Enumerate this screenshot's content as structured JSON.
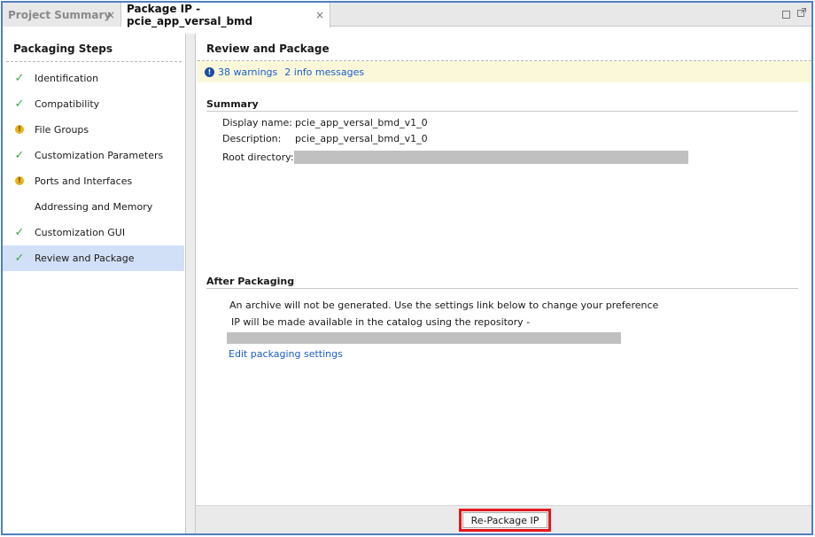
{
  "tabs": [
    {
      "label": "Project Summary",
      "active": false
    },
    {
      "label": "Package IP - pcie_app_versal_bmd",
      "active": true
    }
  ],
  "tab_close_glyph": "×",
  "left_panel": {
    "title": "Packaging Steps",
    "steps": [
      {
        "label": "Identification",
        "status": "check"
      },
      {
        "label": "Compatibility",
        "status": "check"
      },
      {
        "label": "File Groups",
        "status": "warning"
      },
      {
        "label": "Customization Parameters",
        "status": "check"
      },
      {
        "label": "Ports and Interfaces",
        "status": "warning"
      },
      {
        "label": "Addressing and Memory",
        "status": "none"
      },
      {
        "label": "Customization GUI",
        "status": "check"
      },
      {
        "label": "Review and Package",
        "status": "check",
        "selected": true
      }
    ]
  },
  "right_panel": {
    "title": "Review and Package",
    "messages": {
      "warnings": "38 warnings",
      "info": "2 info messages"
    },
    "summary": {
      "title": "Summary",
      "display_name_label": "Display name:",
      "display_name_value": "pcie_app_versal_bmd_v1_0",
      "description_label": "Description:",
      "description_value": "pcie_app_versal_bmd_v1_0",
      "root_dir_label": "Root directory:"
    },
    "after_packaging": {
      "title": "After Packaging",
      "line1": "An archive will not be generated. Use the settings link below to change your preference",
      "line2": "IP will be made available in the catalog using the repository -",
      "edit_link": "Edit packaging settings"
    }
  },
  "footer": {
    "repackage_label": "Re-Package IP"
  },
  "colors": {
    "accent_border": "#4f7fc0",
    "check": "#3aa84a",
    "warning": "#e8b21e",
    "link": "#1a5ed0",
    "highlight": "#e0191e",
    "selection": "#d2e0f7",
    "message_bg": "#fbf8d9"
  }
}
